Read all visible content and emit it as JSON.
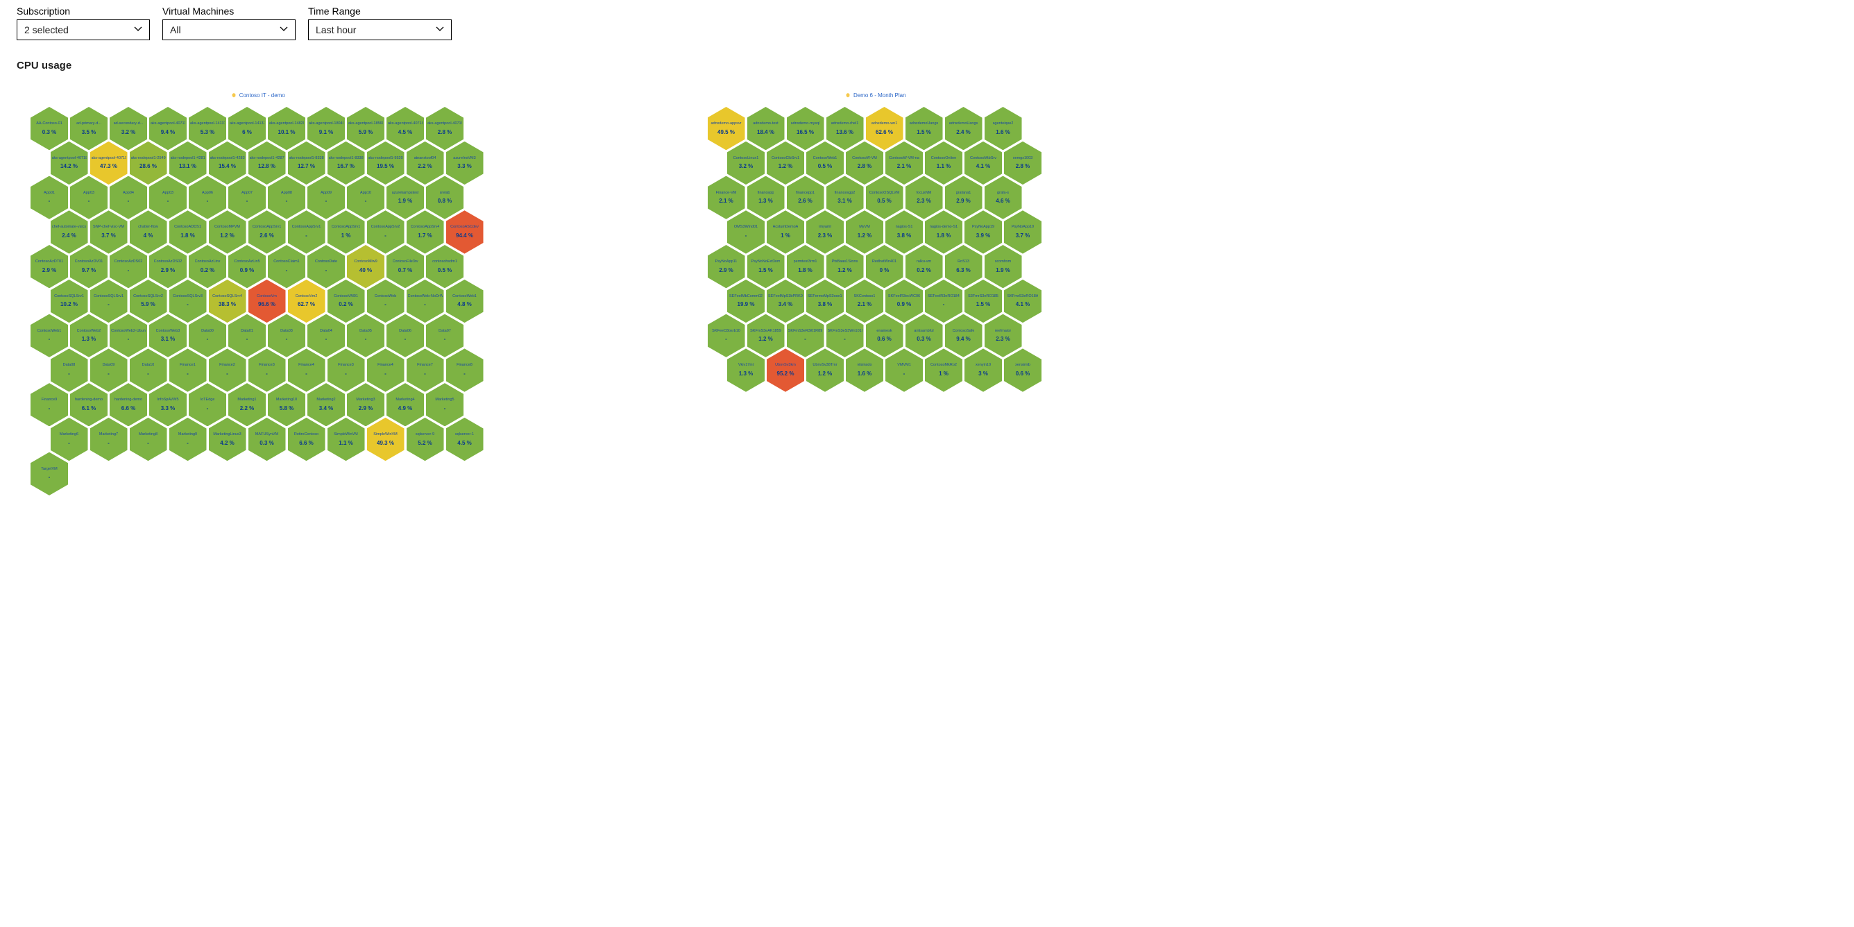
{
  "filters": {
    "subscription": {
      "label": "Subscription",
      "value": "2 selected"
    },
    "vms": {
      "label": "Virtual Machines",
      "value": "All"
    },
    "timerange": {
      "label": "Time Range",
      "value": "Last hour"
    }
  },
  "section_title": "CPU usage",
  "chart_data": [
    {
      "type": "heatmap",
      "title": "Contoso IT - demo",
      "metric": "CPU usage %",
      "rows": [
        [
          {
            "name": "AA-Contoso-01",
            "v": 0.3
          },
          {
            "name": "ad-primary-d...",
            "v": 3.5
          },
          {
            "name": "ad-secondary-d...",
            "v": 3.2
          },
          {
            "name": "aks-agentpool-40711",
            "v": 9.4
          },
          {
            "name": "aks-agentpool-14131",
            "v": 5.3
          },
          {
            "name": "aks-agentpool-14132",
            "v": 6
          },
          {
            "name": "aks-agentpool-14820",
            "v": 10.1
          },
          {
            "name": "aks-agentpool-18040",
            "v": 9.1
          },
          {
            "name": "aks-agentpool-18560",
            "v": 5.9
          },
          {
            "name": "aks-agentpool-40718",
            "v": 4.5
          },
          {
            "name": "aks-agentpool-40719",
            "v": 2.8
          }
        ],
        [
          {
            "name": "aks-agentpool-40718",
            "v": 14.2
          },
          {
            "name": "aks-agentpool-40719",
            "v": 47.3
          },
          {
            "name": "aks-nodepool1-2549...",
            "v": 28.6
          },
          {
            "name": "aks-nodepool1-4281",
            "v": 13.1
          },
          {
            "name": "aks-nodepool1-4283",
            "v": 15.4
          },
          {
            "name": "aks-nodepool1-4287",
            "v": 12.8
          },
          {
            "name": "aks-nodepool1-8338",
            "v": 12.7
          },
          {
            "name": "aks-nodepool1-8338",
            "v": 16.7
          },
          {
            "name": "aks-nodepool1-9520",
            "v": 19.5
          },
          {
            "name": "atnanstoof04",
            "v": 2.2
          },
          {
            "name": "azureInsVM3",
            "v": 3.3
          }
        ],
        [
          {
            "name": "App01",
            "v": null
          },
          {
            "name": "App03",
            "v": null
          },
          {
            "name": "App04",
            "v": null
          },
          {
            "name": "App03",
            "v": null
          },
          {
            "name": "App06",
            "v": null
          },
          {
            "name": "App07",
            "v": null
          },
          {
            "name": "App08",
            "v": null
          },
          {
            "name": "App09",
            "v": null
          },
          {
            "name": "App10",
            "v": null
          },
          {
            "name": "azurekampstest",
            "v": 1.9
          },
          {
            "name": "srelab",
            "v": 0.8
          }
        ],
        [
          {
            "name": "chef-automate-vsics",
            "v": 2.4
          },
          {
            "name": "SNP-chef-visc-VM",
            "v": 3.7
          },
          {
            "name": "chatter-flow",
            "v": 4
          },
          {
            "name": "ContosoADDS1",
            "v": 1.8
          },
          {
            "name": "ContosoMPVM",
            "v": 1.2
          },
          {
            "name": "ContosoAppSrv1",
            "v": 2.6
          },
          {
            "name": "ContosoAppSrv1",
            "v": null
          },
          {
            "name": "ContosoAppSrv1",
            "v": 1
          },
          {
            "name": "ContosoAppSrv2",
            "v": null
          },
          {
            "name": "ContosoAppSrv4",
            "v": 1.7
          },
          {
            "name": "ContosoASCdev",
            "v": 94.4
          }
        ],
        [
          {
            "name": "ContosoAzDT01",
            "v": 2.9
          },
          {
            "name": "ContosoAzDV01",
            "v": 9.7
          },
          {
            "name": "ContosoAzDS02",
            "v": null
          },
          {
            "name": "ContosoAzDS02",
            "v": 2.9
          },
          {
            "name": "ContosoAzLinx",
            "v": 0.2
          },
          {
            "name": "ContosoAzLin5",
            "v": 0.9
          },
          {
            "name": "ContosoClaim1",
            "v": null
          },
          {
            "name": "ContosoDate",
            "v": null
          },
          {
            "name": "ContosoMlw9",
            "v": 40
          },
          {
            "name": "ContosoFile3rv",
            "v": 0.7
          },
          {
            "name": "contosohsdm1",
            "v": 0.5
          }
        ],
        [
          {
            "name": "ContosoSQLSrv1",
            "v": 10.2
          },
          {
            "name": "ContosoSQLSrv1",
            "v": null
          },
          {
            "name": "ContosoSQLSrv2",
            "v": 5.9
          },
          {
            "name": "ContosoSQLSrv3",
            "v": null
          },
          {
            "name": "ContosoSQLSrv4",
            "v": 38.3
          },
          {
            "name": "ContosoVm",
            "v": 96.6
          },
          {
            "name": "ContosoVm2",
            "v": 62.7
          },
          {
            "name": "ContosoVM01",
            "v": 0.2
          },
          {
            "name": "ContosoWeb",
            "v": null
          },
          {
            "name": "ContosoWeb-NoDrW",
            "v": null
          },
          {
            "name": "ContosoWeb1",
            "v": 4.8
          }
        ],
        [
          {
            "name": "ContosoWeb1",
            "v": null
          },
          {
            "name": "ContosoWeb2",
            "v": 1.3
          },
          {
            "name": "ContosoWeb2-Ubun",
            "v": null
          },
          {
            "name": "ContosoWeb3",
            "v": 3.1
          },
          {
            "name": "Data00",
            "v": null
          },
          {
            "name": "Data01",
            "v": null
          },
          {
            "name": "Data03",
            "v": null
          },
          {
            "name": "Data04",
            "v": null
          },
          {
            "name": "Data05",
            "v": null
          },
          {
            "name": "Data06",
            "v": null
          },
          {
            "name": "Data07",
            "v": null
          }
        ],
        [
          {
            "name": "Data08",
            "v": null
          },
          {
            "name": "Data09",
            "v": null
          },
          {
            "name": "Data10",
            "v": null
          },
          {
            "name": "Finance1",
            "v": null
          },
          {
            "name": "Finance2",
            "v": null
          },
          {
            "name": "Finance3",
            "v": null
          },
          {
            "name": "Finance4",
            "v": null
          },
          {
            "name": "Finance3",
            "v": null
          },
          {
            "name": "Finance4",
            "v": null
          },
          {
            "name": "Finance7",
            "v": null
          },
          {
            "name": "Finance8",
            "v": null
          }
        ],
        [
          {
            "name": "Finance9",
            "v": null
          },
          {
            "name": "hardening-demo",
            "v": 6.1
          },
          {
            "name": "hardening-demo",
            "v": 6.6
          },
          {
            "name": "InfoSpAVW5",
            "v": 3.3
          },
          {
            "name": "IoTEdge",
            "v": null
          },
          {
            "name": "Marketing1",
            "v": 2.2
          },
          {
            "name": "Marketing10",
            "v": 5.8
          },
          {
            "name": "Marketing2",
            "v": 3.4
          },
          {
            "name": "Marketing3",
            "v": 2.9
          },
          {
            "name": "Marketing4",
            "v": 4.9
          },
          {
            "name": "Marketing5",
            "v": null
          }
        ],
        [
          {
            "name": "Marketing6",
            "v": null
          },
          {
            "name": "Marketing7",
            "v": null
          },
          {
            "name": "Marketing8",
            "v": null
          },
          {
            "name": "Marketing9",
            "v": null
          },
          {
            "name": "MarketingLinux3",
            "v": 4.2
          },
          {
            "name": "MAFUSynVM",
            "v": 0.3
          },
          {
            "name": "RetiroContoso",
            "v": 6.6
          },
          {
            "name": "SimpleWinVM",
            "v": 1.1
          },
          {
            "name": "SimpleWinVM",
            "v": 49.3
          },
          {
            "name": "sqlserver-9",
            "v": 5.2
          },
          {
            "name": "sqlserver-1",
            "v": 4.5
          }
        ],
        [
          {
            "name": "TargetVM",
            "v": null
          }
        ]
      ]
    },
    {
      "type": "heatmap",
      "title": "Demo 6 - Month Plan",
      "metric": "CPU usage %",
      "rows": [
        [
          {
            "name": "adnxdemo-appsvr",
            "v": 49.5
          },
          {
            "name": "adnxdemo-test",
            "v": 18.4
          },
          {
            "name": "adnxdemo-mysql",
            "v": 16.5
          },
          {
            "name": "adnxdemo-rhel1",
            "v": 13.6
          },
          {
            "name": "adnxdemo-wn1",
            "v": 62.6
          },
          {
            "name": "adnxdemoUangs",
            "v": 1.5
          },
          {
            "name": "adnxdemoUangs",
            "v": 2.4
          },
          {
            "name": "agenteiqax2",
            "v": 1.6
          }
        ],
        [
          {
            "name": "ContosoLinux1",
            "v": 3.2
          },
          {
            "name": "ContosoClbSrv1",
            "v": 1.2
          },
          {
            "name": "ContosoWeb1",
            "v": 0.5
          },
          {
            "name": "ContosoW-VM",
            "v": 2.8
          },
          {
            "name": "ContosoW-VM-na",
            "v": 2.1
          },
          {
            "name": "ContosoOnline",
            "v": 1.1
          },
          {
            "name": "ContosoMtbSrv",
            "v": 4.1
          },
          {
            "name": "xemgx1003",
            "v": 2.8
          }
        ],
        [
          {
            "name": "Finance-VM",
            "v": 2.1
          },
          {
            "name": "financepp",
            "v": 1.3
          },
          {
            "name": "financepp1",
            "v": 2.6
          },
          {
            "name": "financesgp2",
            "v": 3.1
          },
          {
            "name": "ContosoOSQLVM",
            "v": 0.5
          },
          {
            "name": "focusNM",
            "v": 2.3
          },
          {
            "name": "grafana1",
            "v": 2.9
          },
          {
            "name": "grafa-s",
            "v": 4.6
          }
        ],
        [
          {
            "name": "OMS3Wind01",
            "v": null
          },
          {
            "name": "AcstumDemoA",
            "v": 1
          },
          {
            "name": "imyaml",
            "v": 2.3
          },
          {
            "name": "MyVM",
            "v": 1.2
          },
          {
            "name": "nagios-S1",
            "v": 3.8
          },
          {
            "name": "nagios-demo-S1",
            "v": 1.8
          },
          {
            "name": "PsyNoApp19",
            "v": 3.9
          },
          {
            "name": "PsyNoApp10",
            "v": 3.7
          }
        ],
        [
          {
            "name": "PsyNoApp11",
            "v": 2.9
          },
          {
            "name": "PsyNoNoExt3om",
            "v": 1.5
          },
          {
            "name": "permtest3rm1",
            "v": 1.8
          },
          {
            "name": "PtsBaas1Stons",
            "v": 1.2
          },
          {
            "name": "RedhatWn401",
            "v": 0
          },
          {
            "name": "ralku-vm",
            "v": 0.2
          },
          {
            "name": "RoS13",
            "v": 6.3
          },
          {
            "name": "scomhxm",
            "v": 1.9
          }
        ],
        [
          {
            "name": "SEFeelMbComm02",
            "v": 19.9
          },
          {
            "name": "SEFeelMpS3bPRK018",
            "v": 3.4
          },
          {
            "name": "SEFermoMpS3ose10",
            "v": 3.8
          },
          {
            "name": "SKContoso1",
            "v": 2.1
          },
          {
            "name": "SKFeelR3ecWC06",
            "v": 0.9
          },
          {
            "name": "SEFeelR3eRO184",
            "v": null
          },
          {
            "name": "S3FmrS3eRO185",
            "v": 1.5
          },
          {
            "name": "SKFmrS3eRO18A",
            "v": 4.1
          }
        ],
        [
          {
            "name": "SKFeeC8osrb10",
            "v": null
          },
          {
            "name": "SKFmS3eAK1859",
            "v": 1.2
          },
          {
            "name": "SKFmS3eR3i01R89",
            "v": null
          },
          {
            "name": "SKFmS3eS3Wn1010",
            "v": null
          },
          {
            "name": "enamesk",
            "v": 0.6
          },
          {
            "name": "antisambful",
            "v": 0.3
          },
          {
            "name": "ContosoSafe",
            "v": 9.4
          },
          {
            "name": "reefmator",
            "v": 2.3
          }
        ],
        [
          {
            "name": "Vkiv17int",
            "v": 1.3
          },
          {
            "name": "UbnvSv3km",
            "v": 95.2
          },
          {
            "name": "UbnvSv38Tmr",
            "v": 1.2
          },
          {
            "name": "viisinsdo",
            "v": 1.6
          },
          {
            "name": "VMVM1",
            "v": null
          },
          {
            "name": "ContosoMkRo2",
            "v": 1
          },
          {
            "name": "xenyin10",
            "v": 3
          },
          {
            "name": "xensimib",
            "v": 0.6
          }
        ]
      ]
    }
  ]
}
